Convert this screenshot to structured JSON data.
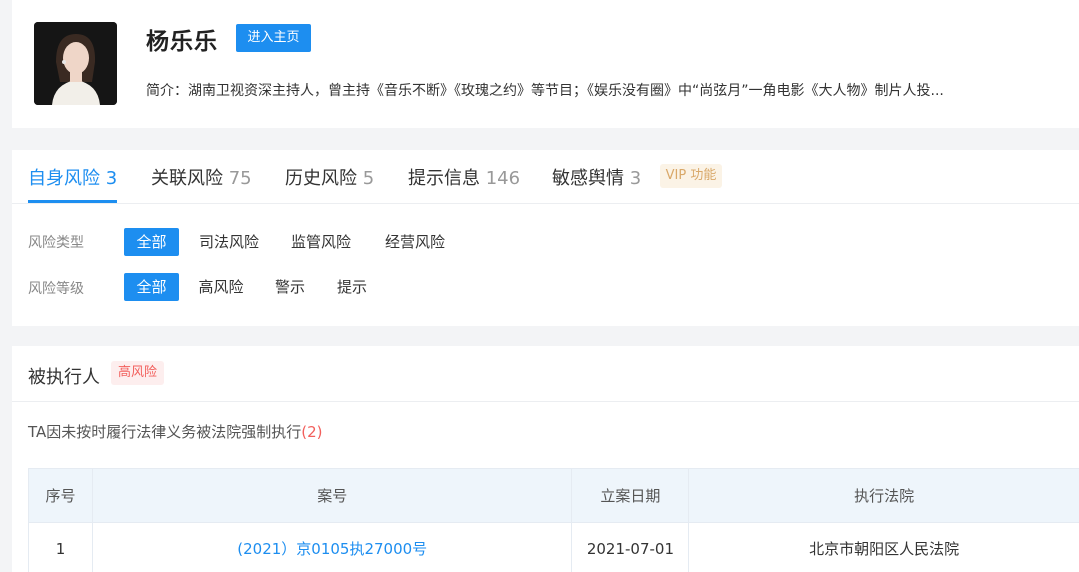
{
  "profile": {
    "name": "杨乐乐",
    "home_button": "进入主页",
    "intro": "简介：湖南卫视资深主持人，曾主持《音乐不断》《玫瑰之约》等节目；《娱乐没有圈》中“尚弦月”一角电影《大人物》制片人投..."
  },
  "risk_tabs": [
    {
      "label": "自身风险",
      "count": "3",
      "active": true
    },
    {
      "label": "关联风险",
      "count": "75"
    },
    {
      "label": "历史风险",
      "count": "5"
    },
    {
      "label": "提示信息",
      "count": "146"
    },
    {
      "label": "敏感舆情",
      "count": "3"
    }
  ],
  "vip_badge": "VIP 功能",
  "filters": {
    "type": {
      "label": "风险类型",
      "options": [
        "全部",
        "司法风险",
        "监管风险",
        "经营风险"
      ],
      "selected": "全部"
    },
    "level": {
      "label": "风险等级",
      "options": [
        "全部",
        "高风险",
        "警示",
        "提示"
      ],
      "selected": "全部"
    }
  },
  "executed": {
    "title": "被执行人",
    "badge": "高风险",
    "description": "TA因未按时履行法律义务被法院强制执行",
    "count": "(2)",
    "columns": [
      "序号",
      "案号",
      "立案日期",
      "执行法院"
    ],
    "rows": [
      {
        "index": "1",
        "case_no": "(2021）京0105执27000号",
        "date": "2021-07-01",
        "court": "北京市朝阳区人民法院"
      }
    ]
  },
  "colors": {
    "accent": "#1d8ef0",
    "danger": "#f25f5c",
    "vip": "#d9a869"
  }
}
